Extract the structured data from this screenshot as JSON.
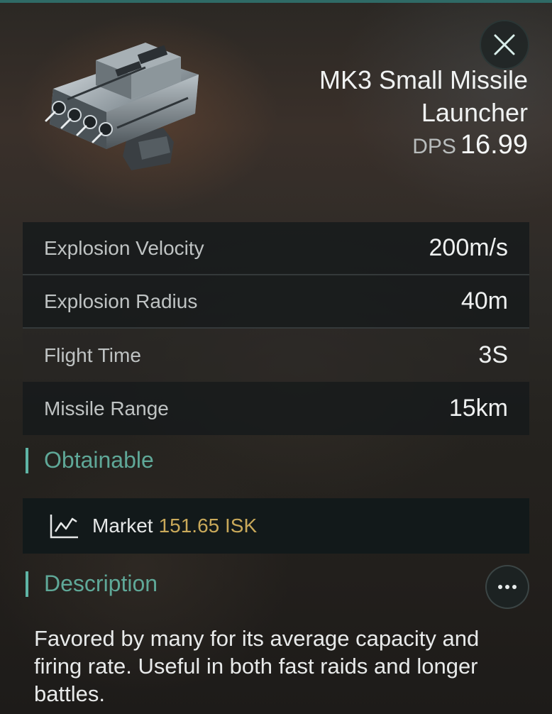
{
  "item": {
    "name": "MK3 Small Missile Launcher",
    "dps_label": "DPS",
    "dps_value": "16.99",
    "image_icon": "missile-launcher-icon"
  },
  "header": {
    "close_icon": "close-icon"
  },
  "stats": [
    {
      "label": "Explosion Velocity",
      "value": "200m/s"
    },
    {
      "label": "Explosion Radius",
      "value": "40m"
    },
    {
      "label": "Flight Time",
      "value": "3S"
    },
    {
      "label": "Missile Range",
      "value": "15km"
    }
  ],
  "obtainable": {
    "title": "Obtainable",
    "market_icon": "market-chart-icon",
    "market_label": "Market",
    "market_price": "151.65 ISK"
  },
  "description": {
    "title": "Description",
    "more_icon": "more-options-icon",
    "text": "Favored by many for its average capacity and firing rate. Useful in both fast raids and longer battles."
  },
  "colors": {
    "accent_teal": "#5fb5a6",
    "price_gold": "#c9a95a",
    "top_bar": "#2f6a66"
  }
}
